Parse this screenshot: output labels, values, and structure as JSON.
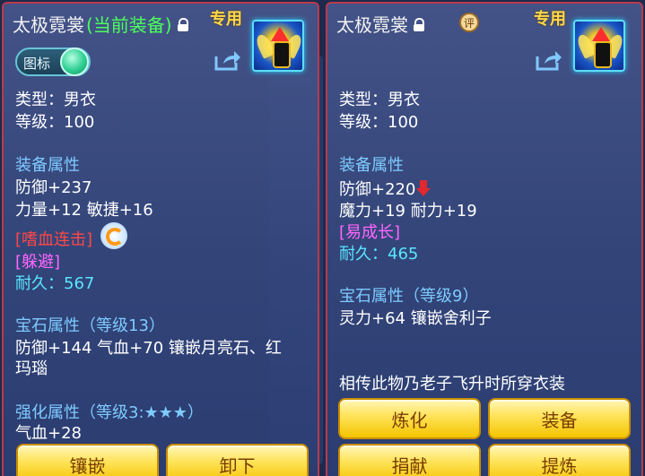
{
  "left": {
    "item_name": "太极霓裳",
    "equipped_tag": "(当前装备)",
    "special_label": "专用",
    "toggle_label": "图标",
    "type": "类型：男衣",
    "level": "等级：100",
    "equip_attr_header": "装备属性",
    "defense": "防御+237",
    "stats": "力量+12 敏捷+16",
    "effect_skill": "[嗜血连击]",
    "effect_dodge": "[躲避]",
    "durability_label": "耐久：",
    "durability_value": "567",
    "gem_header": "宝石属性（等级13）",
    "gem_line1": "防御+144 气血+70 镶嵌月亮石、红",
    "gem_line2": "玛瑙",
    "enhance_header": "强化属性（等级3:★★★）",
    "enhance_line": "气血+28",
    "buttons": {
      "inlay": "镶嵌",
      "unequip": "卸下"
    }
  },
  "right": {
    "item_name": "太极霓裳",
    "rate_badge": "评",
    "special_label": "专用",
    "type": "类型：男衣",
    "level": "等级：100",
    "equip_attr_header": "装备属性",
    "defense": "防御+220",
    "stats": "魔力+19 耐力+19",
    "effect_growth": "[易成长]",
    "durability_label": "耐久：",
    "durability_value": "465",
    "gem_header": "宝石属性（等级9）",
    "gem_line": "灵力+64 镶嵌舍利子",
    "description": "相传此物乃老子飞升时所穿衣装",
    "buttons": {
      "refine": "炼化",
      "equip": "装备",
      "donate": "捐献",
      "extract": "提炼"
    }
  },
  "icons": [
    "lock-icon",
    "share-icon",
    "refresh-icon",
    "down-arrow-icon",
    "rate-badge",
    "item-icon"
  ]
}
